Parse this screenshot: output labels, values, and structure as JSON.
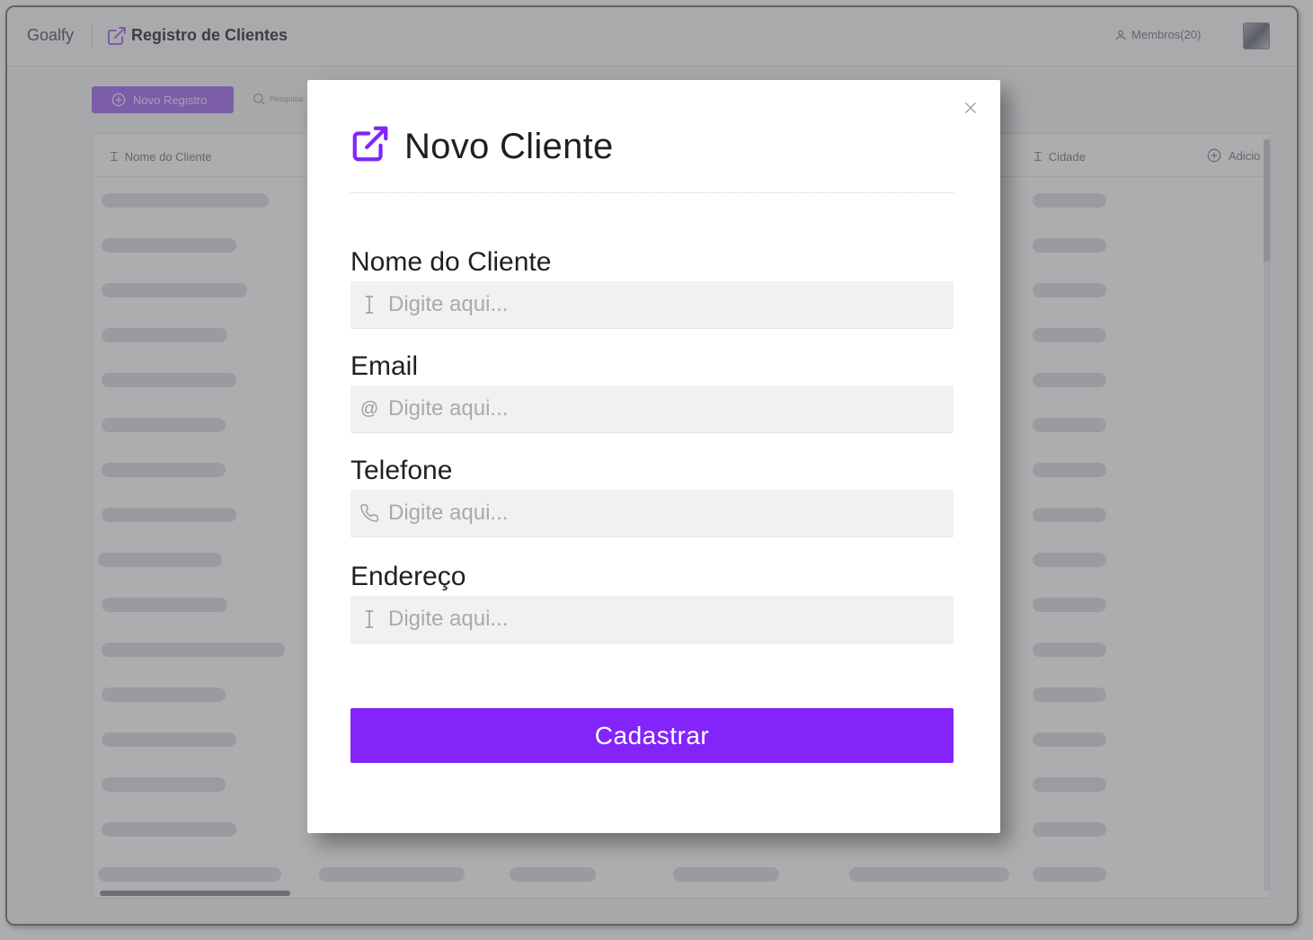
{
  "app": {
    "brand": "Goalfy",
    "page_title": "Registro de Clientes",
    "members_label": "Membros(20)"
  },
  "toolbar": {
    "new_record_label": "Novo Registro",
    "search_placeholder": "Pesquisa"
  },
  "table": {
    "columns": [
      "Nome do Cliente",
      "Cidade",
      "Adicio"
    ]
  },
  "modal": {
    "title": "Novo Cliente",
    "fields": [
      {
        "label": "Nome do Cliente",
        "placeholder": "Digite aqui...",
        "icon": "text-cursor-icon"
      },
      {
        "label": "Email",
        "placeholder": "Digite aqui...",
        "icon": "at-icon"
      },
      {
        "label": "Telefone",
        "placeholder": "Digite aqui...",
        "icon": "phone-icon"
      },
      {
        "label": "Endereço",
        "placeholder": "Digite aqui...",
        "icon": "text-cursor-icon"
      }
    ],
    "submit_label": "Cadastrar"
  },
  "colors": {
    "accent": "#8224fa",
    "accent_light": "#b07ef5",
    "overlay": "#28282c"
  }
}
